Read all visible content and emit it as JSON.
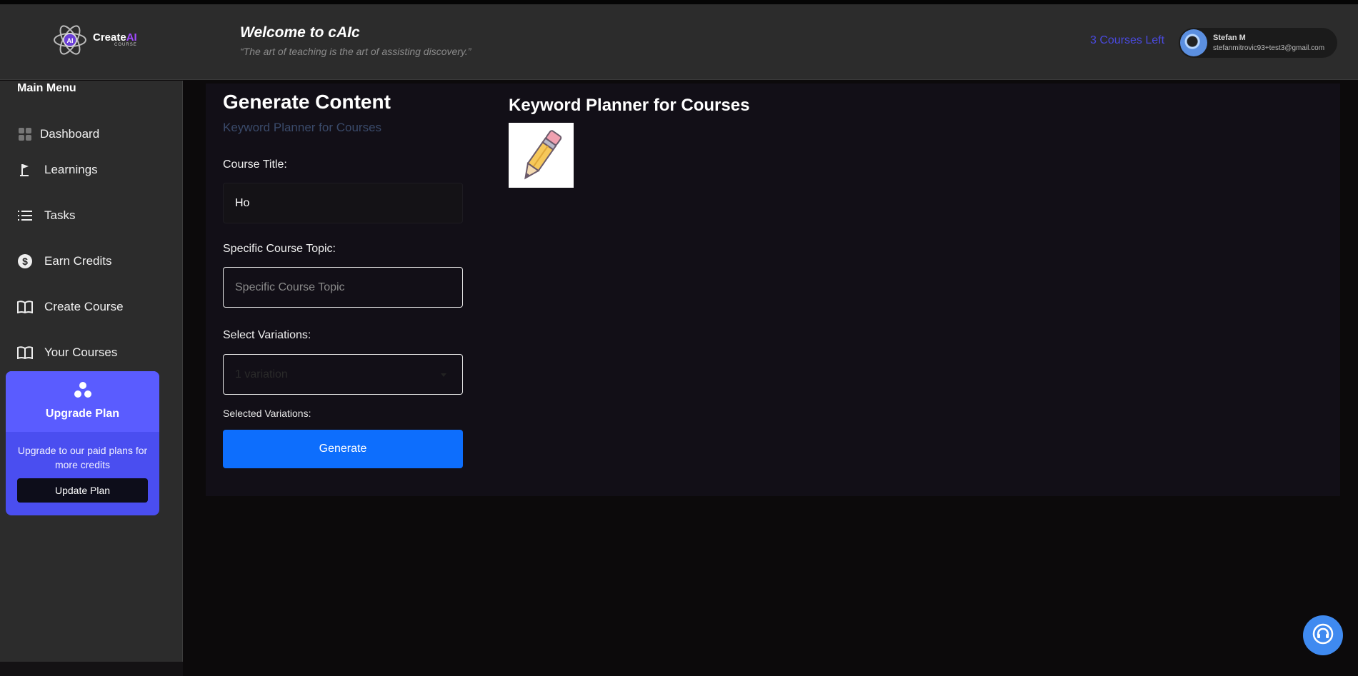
{
  "header": {
    "logo": {
      "text_main": "Create",
      "text_ai": "AI",
      "text_sub": "COURSE",
      "badge": "AI"
    },
    "welcome_title": "Welcome to cAIc",
    "welcome_quote": "“The art of teaching is the art of assisting discovery.”",
    "courses_left": "3 Courses Left",
    "user": {
      "name": "Stefan M",
      "email": "stefanmitrovic93+test3@gmail.com"
    }
  },
  "sidebar": {
    "title": "Main Menu",
    "items": [
      {
        "label": "Dashboard",
        "icon": "grid-icon"
      },
      {
        "label": "Learnings",
        "icon": "flag-icon"
      },
      {
        "label": "Tasks",
        "icon": "list-icon"
      },
      {
        "label": "Earn Credits",
        "icon": "dollar-icon"
      },
      {
        "label": "Create Course",
        "icon": "book-icon"
      },
      {
        "label": "Your Courses",
        "icon": "book-icon"
      }
    ],
    "upgrade": {
      "title": "Upgrade Plan",
      "description": "Upgrade to our paid plans for more credits",
      "button": "Update Plan"
    }
  },
  "form": {
    "title": "Generate Content",
    "subtitle": "Keyword Planner for Courses",
    "course_title_label": "Course Title:",
    "course_title_value": "Ho",
    "topic_label": "Specific Course Topic:",
    "topic_placeholder": "Specific Course Topic",
    "variations_label": "Select Variations:",
    "variations_value": "1 variation",
    "selected_variations_label": "Selected Variations:",
    "generate_button": "Generate"
  },
  "preview": {
    "title": "Keyword Planner for Courses",
    "image_icon": "pencil-icon"
  },
  "colors": {
    "accent": "#0d6efd",
    "upgrade_bg": "#5a5cff",
    "courses_left": "#4a4adf",
    "support": "#3f8af0"
  }
}
